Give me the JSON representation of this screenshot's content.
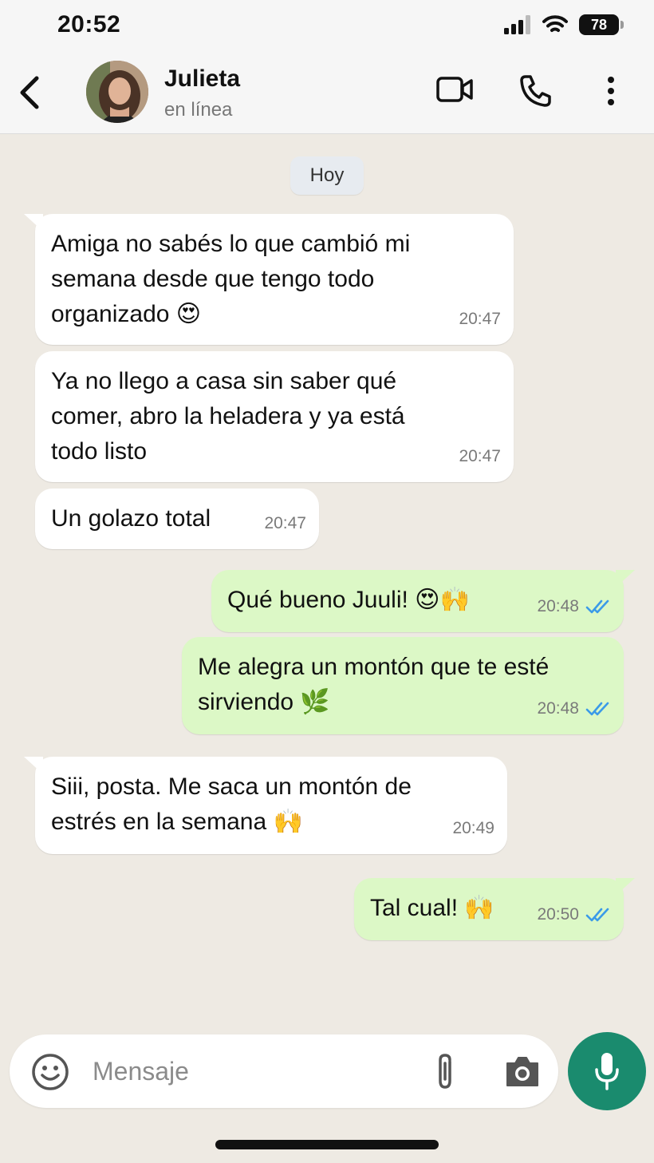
{
  "status": {
    "time": "20:52",
    "battery": "78"
  },
  "header": {
    "name": "Julieta",
    "presence": "en línea"
  },
  "chat": {
    "day": "Hoy",
    "messages": [
      {
        "text": "Amiga no sabés lo que cambió mi\nsemana desde que tengo todo\norganizado 😍",
        "time": "20:47"
      },
      {
        "text": "Ya no llego a casa sin saber qué\ncomer, abro la heladera y ya está\ntodo listo",
        "time": "20:47"
      },
      {
        "text": "Un golazo total",
        "time": "20:47"
      },
      {
        "text": "Qué bueno Juuli! 😍🙌",
        "time": "20:48"
      },
      {
        "text": "Me alegra un montón que te esté\nsirviendo 🌿",
        "time": "20:48"
      },
      {
        "text": "Siii, posta. Me saca un montón de\nestrés en la semana 🙌",
        "time": "20:49"
      },
      {
        "text": "Tal cual! 🙌",
        "time": "20:50"
      }
    ]
  },
  "composer": {
    "placeholder": "Mensaje"
  },
  "colors": {
    "incoming": "#ffffff",
    "outgoing": "#dcf8c6",
    "accent": "#1a8b6e",
    "ticks": "#3b9ae8"
  }
}
